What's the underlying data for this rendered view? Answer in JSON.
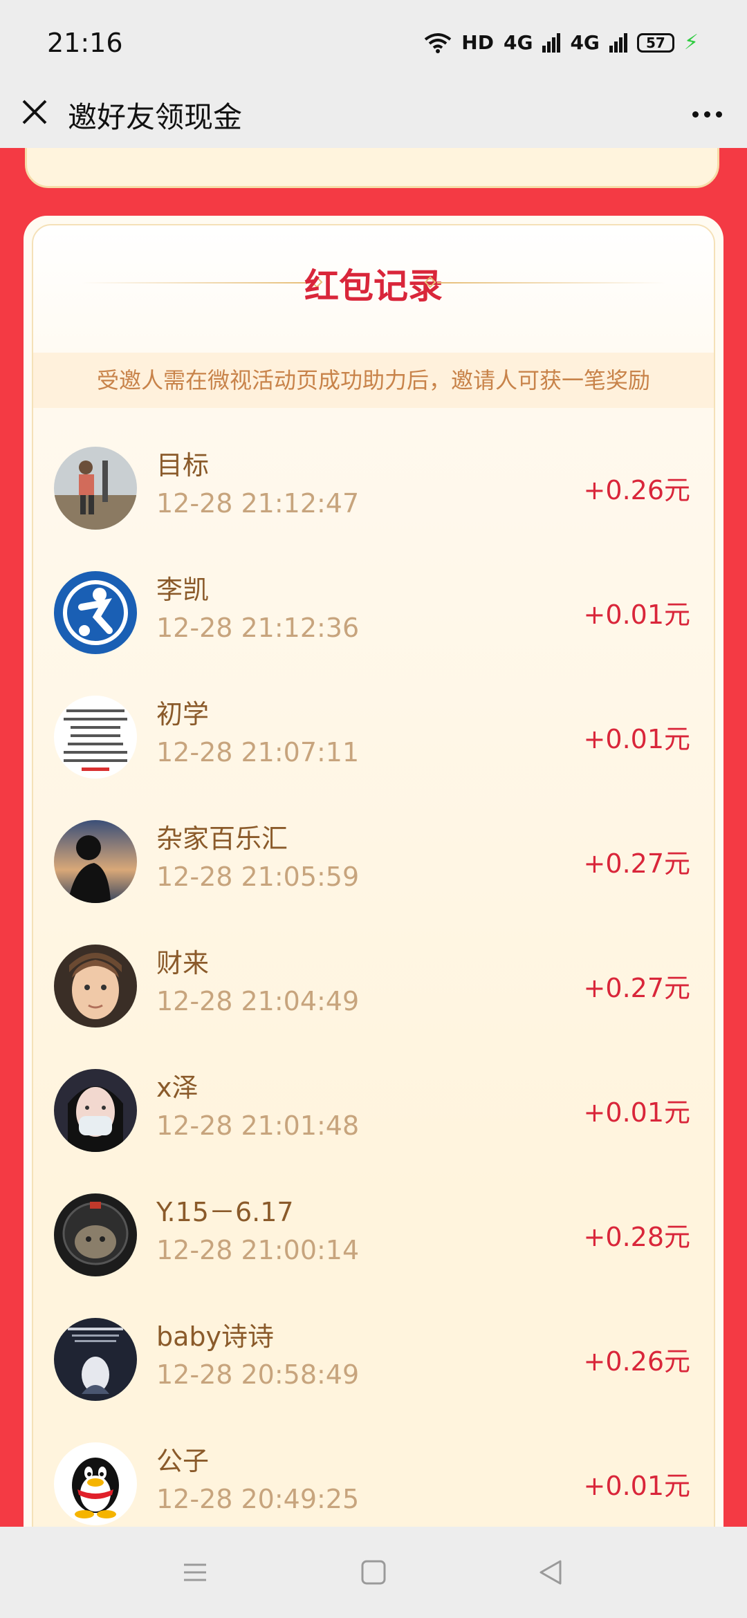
{
  "status_bar": {
    "time": "21:16",
    "network_label": "HD",
    "signal1": "4G",
    "signal2": "4G",
    "battery": "57"
  },
  "title_bar": {
    "title": "邀好友领现金",
    "close_icon": "close-icon",
    "more_icon": "more-icon"
  },
  "card": {
    "title": "红包记录",
    "notice": "受邀人需在微视活动页成功助力后，邀请人可获一笔奖励"
  },
  "records": [
    {
      "name": "目标",
      "time": "12-28 21:12:47",
      "amount": "+0.26元",
      "avatar_color": "#7a8a90"
    },
    {
      "name": "李凯",
      "time": "12-28 21:12:36",
      "amount": "+0.01元",
      "avatar_color": "#1a5fb4"
    },
    {
      "name": "初学",
      "time": "12-28 21:07:11",
      "amount": "+0.01元",
      "avatar_color": "#ffffff"
    },
    {
      "name": "杂家百乐汇",
      "time": "12-28 21:05:59",
      "amount": "+0.27元",
      "avatar_color": "#5a6f8a"
    },
    {
      "name": "财来",
      "time": "12-28 21:04:49",
      "amount": "+0.27元",
      "avatar_color": "#8c6a4f"
    },
    {
      "name": "x泽",
      "time": "12-28 21:01:48",
      "amount": "+0.01元",
      "avatar_color": "#3a3a4a"
    },
    {
      "name": "Y.15－6.17",
      "time": "12-28 21:00:14",
      "amount": "+0.28元",
      "avatar_color": "#2b2b2b"
    },
    {
      "name": "baby诗诗",
      "time": "12-28 20:58:49",
      "amount": "+0.26元",
      "avatar_color": "#1f2433"
    },
    {
      "name": "公子",
      "time": "12-28 20:49:25",
      "amount": "+0.01元",
      "avatar_color": "#ffffff"
    }
  ],
  "nav_bar": {
    "menu_icon": "menu-icon",
    "home_icon": "home-icon",
    "back_icon": "back-icon"
  }
}
